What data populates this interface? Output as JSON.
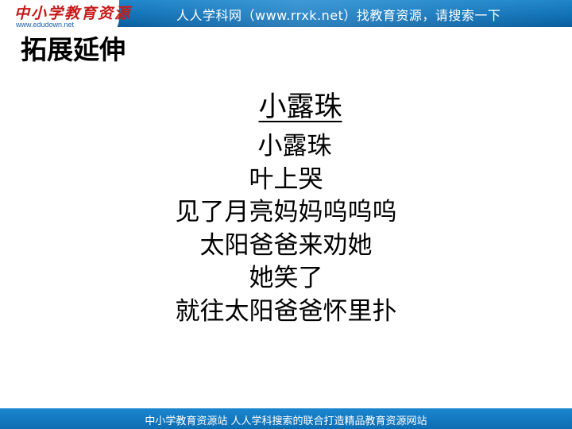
{
  "header": {
    "logo_text": "中小学教育资源",
    "logo_url": "www.edudown.net",
    "slogan": "人人学科网（www.rrxk.net）找教育资源，请搜索一下"
  },
  "slide": {
    "heading": "拓展延伸",
    "poem_title": "小露珠",
    "poem_lines": [
      "小露珠",
      "叶上哭",
      "见了月亮妈妈呜呜呜",
      "太阳爸爸来劝她",
      "她笑了",
      "就往太阳爸爸怀里扑"
    ]
  },
  "footer": {
    "text": "中小学教育资源站  人人学科搜索的联合打造精品教育资源网站"
  },
  "colors": {
    "banner_blue": "#0f6fb3",
    "logo_red": "#c81818"
  }
}
